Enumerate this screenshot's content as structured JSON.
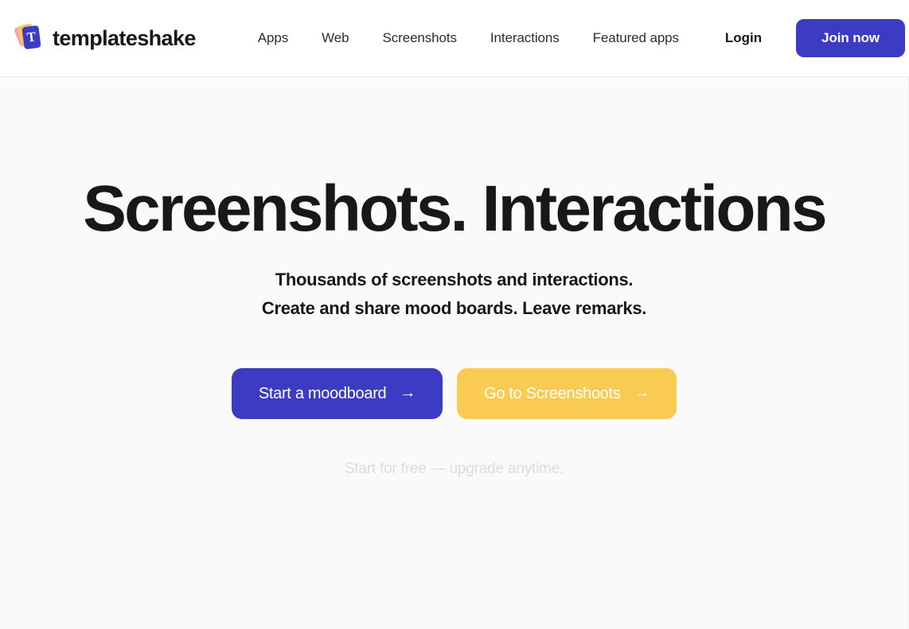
{
  "header": {
    "brand": {
      "name": "templateshake",
      "logo_letter": "T",
      "logo_colors": {
        "front": "#3b3bc4",
        "middle": "#fbc84f",
        "back": "#f6a0c0"
      }
    },
    "nav": [
      {
        "label": "Apps"
      },
      {
        "label": "Web"
      },
      {
        "label": "Screenshots"
      },
      {
        "label": "Interactions"
      },
      {
        "label": "Featured apps"
      }
    ],
    "login_label": "Login",
    "join_label": "Join now",
    "join_color": "#3b3bc4"
  },
  "hero": {
    "title": "Screenshots. Interactions",
    "subtitle_line1": "Thousands of screenshots and interactions.",
    "subtitle_line2": "Create and share mood boards. Leave remarks.",
    "cta_primary": {
      "label": "Start a moodboard",
      "arrow": "→",
      "color": "#3b3bc4"
    },
    "cta_secondary": {
      "label": "Go to Screenshoots",
      "arrow": "→",
      "color": "#f9cb53"
    },
    "note": "Start for free — upgrade anytime."
  }
}
